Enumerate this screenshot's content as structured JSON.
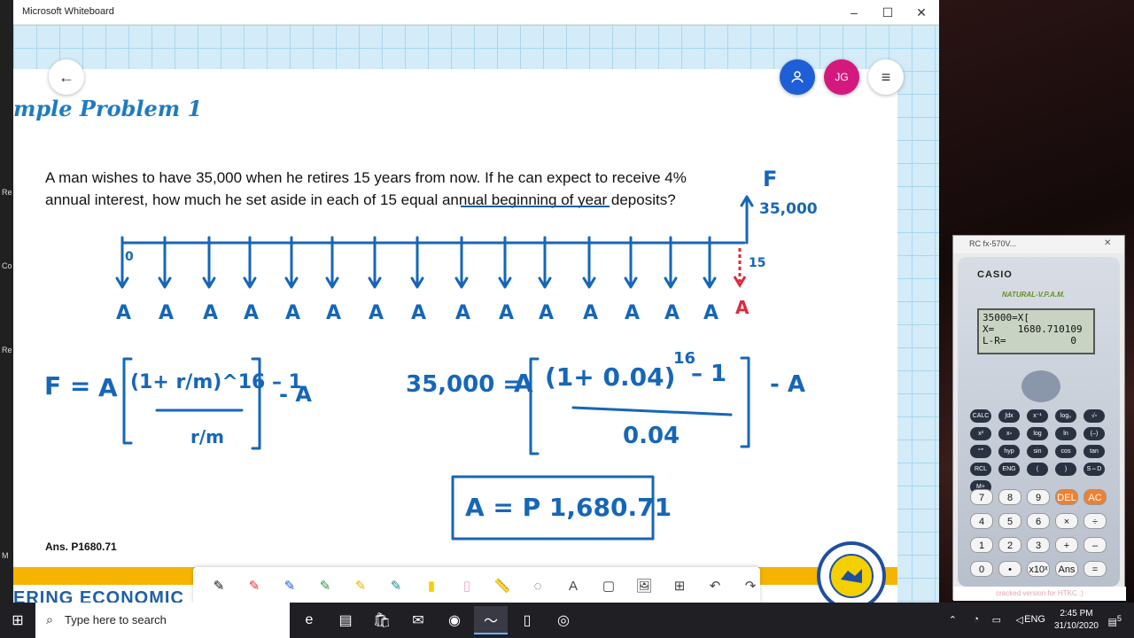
{
  "window": {
    "title": "Microsoft Whiteboard",
    "minimize": "–",
    "maximize": "☐",
    "close": "✕"
  },
  "left_strip": [
    "Re",
    "Co",
    "Re",
    "M"
  ],
  "buttons": {
    "back": "←",
    "user": "👤",
    "avatar": "JG",
    "menu": "≡"
  },
  "slide": {
    "title": "mple Problem 1",
    "problem_line1": "A man wishes to have 35,000 when he retires 15 years from now. If he can expect to receive 4%",
    "problem_line2": "annual interest, how much he set aside in each of 15 equal annual beginning of year deposits?",
    "answer_note": "Ans. P1680.71",
    "band_text": "ERING ECONOMIC"
  },
  "ink": {
    "F_label": "F",
    "F_value": "35,000",
    "zero": "0",
    "fifteen": "15",
    "A": "A",
    "A_red": "A",
    "formula_left": "F =",
    "formula_right_lhs": "35,000 =",
    "formula_A": "A",
    "formula_minus_A": "- A",
    "formula_numer_left": "(1+ r/m)^16 – 1",
    "formula_denom_left": "r/m",
    "formula_numer_right": "(1+ 0.04)",
    "formula_exp_right": "16",
    "formula_minus_one": "– 1",
    "formula_denom_right": "0.04",
    "result": "A = P 1,680.71"
  },
  "toolbar": {
    "tools": [
      "pen-black",
      "pen-red",
      "pen-blue",
      "pen-green",
      "pen-yellow",
      "pen-teal",
      "highlighter-yellow",
      "eraser",
      "ruler",
      "lasso",
      "text",
      "note",
      "image",
      "add",
      "undo",
      "redo"
    ],
    "glyphs": [
      "✎",
      "✎",
      "✎",
      "✎",
      "✎",
      "✎",
      "▮",
      "▯",
      "📏",
      "◌",
      "A",
      "▢",
      "🖼",
      "⊞",
      "↶",
      "↷"
    ]
  },
  "calculator": {
    "title": "RC fx-570V...",
    "brand": "CASIO",
    "model": "NATURAL-V.P.A.M.",
    "screen_line1": "35000=X[",
    "screen_line2": "X=    1680.710109",
    "screen_line3": "L-R=           0",
    "footer": "cracked version for HTKC :)",
    "keys_top": [
      "CALC",
      "∫dx",
      "x⁻¹",
      "log₀",
      "√▫",
      "x²",
      "x▫",
      "log",
      "ln",
      "(–)",
      "°'\"",
      "hyp",
      "sin",
      "cos",
      "tan",
      "RCL",
      "ENG",
      "(",
      ")",
      "S⇔D",
      "M+"
    ],
    "keys_num": [
      "7",
      "8",
      "9",
      "DEL",
      "AC",
      "4",
      "5",
      "6",
      "×",
      "÷",
      "1",
      "2",
      "3",
      "+",
      "–",
      "0",
      "•",
      "x10ˣ",
      "Ans",
      "="
    ]
  },
  "taskbar": {
    "start": "⊞",
    "search_placeholder": "Type here to search",
    "search_icon": "⌕",
    "apps": [
      "edge-icon",
      "file-explorer-icon",
      "store-icon",
      "mail-icon",
      "zoom-icon",
      "whiteboard-icon",
      "calculator-icon",
      "chrome-like-icon"
    ],
    "app_glyphs": [
      "e",
      "▤",
      "🛍",
      "✉",
      "◉",
      "〜",
      "▯",
      "◎"
    ],
    "lang": "ENG",
    "time": "2:45 PM",
    "date": "31/10/2020",
    "notif_count": "5"
  }
}
